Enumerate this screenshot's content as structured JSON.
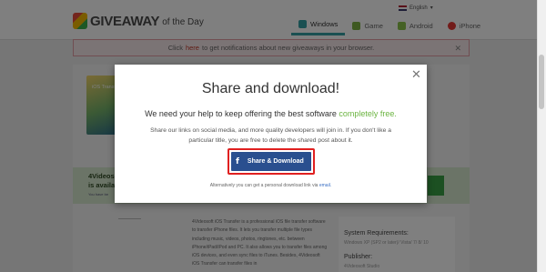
{
  "header": {
    "logo_main": "GIVEAWAY",
    "logo_sub": "of the Day",
    "language": "English",
    "nav": [
      {
        "label": "Windows",
        "color": "#34a0a4"
      },
      {
        "label": "Game",
        "color": "#7cb342"
      },
      {
        "label": "Android",
        "color": "#8bc34a"
      },
      {
        "label": "iPhone",
        "color": "#e53935"
      }
    ]
  },
  "notification": {
    "prefix": "Click",
    "link": "here",
    "suffix": "to get notifications about new giveaways in your browser."
  },
  "background": {
    "product_label": "iOS Transfer",
    "band_title_1": "4Videosof",
    "band_title_2": "is availab",
    "band_small": "You have be",
    "description": "4Videosoft iOS Transfer is a professional iOS file transfer software to transfer iPhone files. It lets you transfer multiple file types including music, videos, photos, ringtones, etc. between iPhone/iPad/iPod and PC. It also allows you to transfer files among iOS devices, and even sync files to iTunes. Besides, 4Videosoft iOS Transfer can transfer files in",
    "sys_req_label": "System Requirements:",
    "sys_req_value": "Windows XP (SP2 or later)/ Vista/ 7/ 8/ 10",
    "publisher_label": "Publisher:",
    "publisher_value": "4Videosoft Studio"
  },
  "modal": {
    "title": "Share and download!",
    "lead_prefix": "We need your help to keep offering the best software",
    "lead_highlight": "completely free.",
    "body": "Share our links on social media, and more quality developers will join in. If you don't like a particular title, you are free to delete the shared post about it.",
    "button_label": "Share & Download",
    "alt_prefix": "Alternatively you can get a personal download link via",
    "alt_link": "email."
  },
  "colors": {
    "accent_green": "#6bb441",
    "button_blue": "#2a4f8f",
    "highlight_red": "#e02020"
  }
}
